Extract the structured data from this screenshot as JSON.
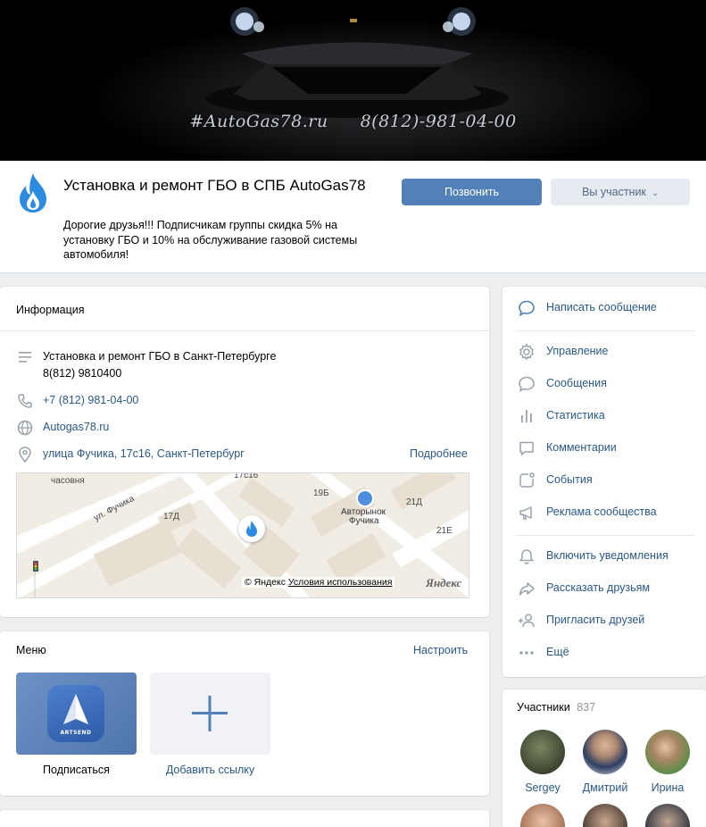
{
  "cover": {
    "text_site": "#AutoGas78.ru",
    "text_phone": "8(812)-981-04-00"
  },
  "header": {
    "title": "Установка и ремонт ГБО в СПБ AutoGas78",
    "status": "Дорогие друзья!!! Подписчикам группы скидка 5% на установку ГБО и 10% на обслуживание газовой системы автомобиля!",
    "call_button": "Позвонить",
    "member_button": "Вы участник"
  },
  "info": {
    "title": "Информация",
    "description_line1": "Установка и ремонт ГБО в Санкт-Петербурге",
    "description_line2": "8(812) 9810400",
    "phone": "+7 (812) 981-04-00",
    "website": "Autogas78.ru",
    "address": "улица Фучика, 17с16, Санкт-Петербург",
    "more_link": "Подробнее",
    "map": {
      "labels": [
        "часовня",
        "ул. Фучика",
        "17с16",
        "19Б",
        "21Д",
        "17Д",
        "21Е"
      ],
      "poi_line1": "Авторынок",
      "poi_line2": "Фучика",
      "copyright": "© Яндекс",
      "terms_link": "Условия использования",
      "brand": "Яндекс"
    }
  },
  "menu": {
    "title": "Меню",
    "configure_link": "Настроить",
    "items": [
      {
        "label": "Подписаться",
        "logo_text": "ARTSEND"
      },
      {
        "label": "Добавить ссылку"
      }
    ]
  },
  "sidebar": {
    "write_message": "Написать сообщение",
    "items": [
      "Управление",
      "Сообщения",
      "Статистика",
      "Комментарии",
      "События",
      "Реклама сообщества"
    ],
    "actions": [
      "Включить уведомления",
      "Рассказать друзьям",
      "Пригласить друзей",
      "Ещё"
    ]
  },
  "members": {
    "title": "Участники",
    "count": "837",
    "list": [
      "Sergey",
      "Дмитрий",
      "Ирина"
    ]
  },
  "colors": {
    "accent": "#5181b8",
    "link": "#2a5885",
    "background": "#edeef0"
  }
}
